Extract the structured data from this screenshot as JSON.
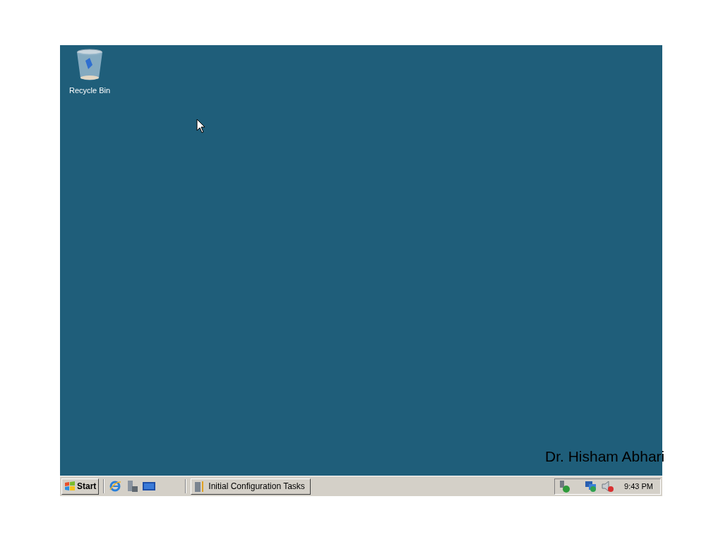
{
  "desktop_icons": [
    {
      "label": "Recycle Bin"
    }
  ],
  "taskbar": {
    "start_label": "Start",
    "buttons": [
      {
        "label": "Initial Configuration Tasks",
        "selected": false
      }
    ],
    "clock": "9:43 PM"
  },
  "caption": "Dr. Hisham Abhari"
}
